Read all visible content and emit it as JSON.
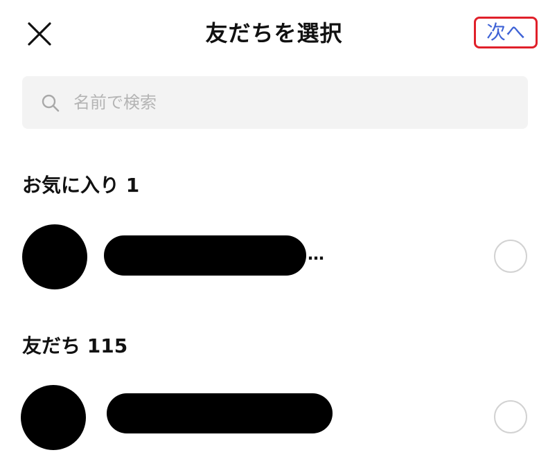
{
  "header": {
    "close_icon": "close-icon",
    "title": "友だちを選択",
    "next_label": "次へ",
    "next_color": "#3f63d6",
    "highlight_color": "#e0202a"
  },
  "search": {
    "icon": "search-icon",
    "placeholder": "名前で検索",
    "value": ""
  },
  "sections": [
    {
      "label": "お気に入り 1",
      "items": [
        {
          "name": "",
          "name_redacted": true,
          "name_truncated": true,
          "ellipsis": "…",
          "selected": false
        }
      ]
    },
    {
      "label": "友だち 115",
      "items": [
        {
          "name": "",
          "name_redacted": true,
          "name_truncated": false,
          "selected": false
        }
      ]
    }
  ]
}
